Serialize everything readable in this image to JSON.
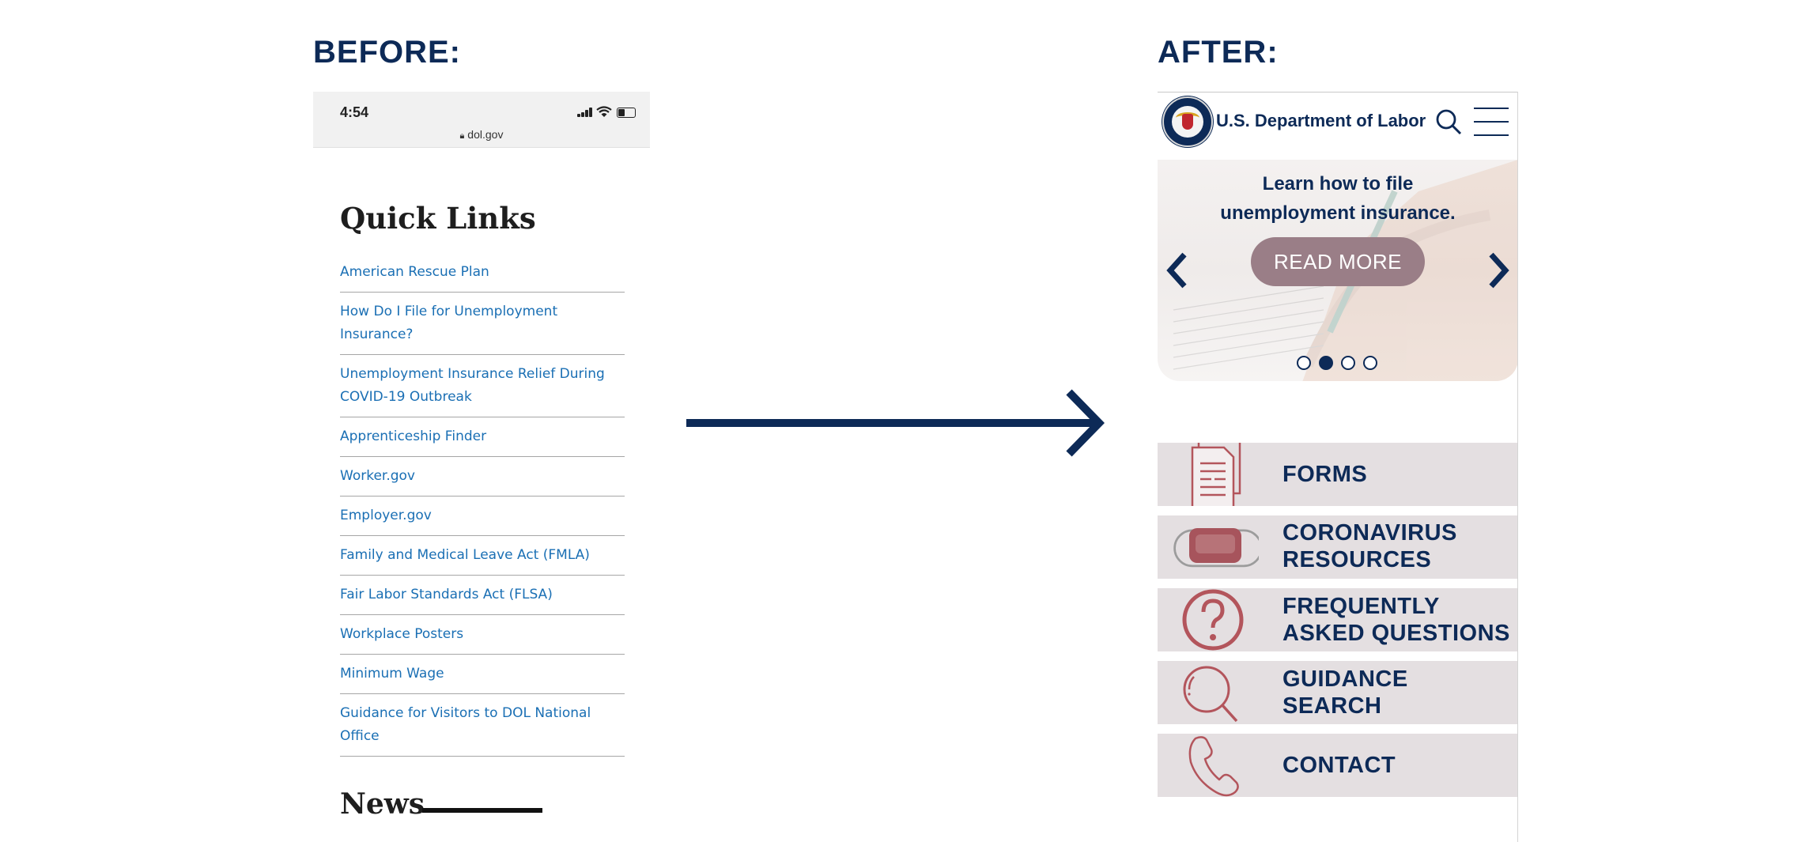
{
  "labels": {
    "before": "BEFORE:",
    "after": "AFTER:"
  },
  "colors": {
    "navy": "#0d2a57",
    "link": "#1a6fb4",
    "tile_bg": "#e4dfe1",
    "icon_red": "#b3555c",
    "button_mauve": "#9a7e87"
  },
  "before": {
    "status": {
      "time": "4:54",
      "url": "dol.gov"
    },
    "quick_links": {
      "title": "Quick Links",
      "items": [
        {
          "label": "American Rescue Plan"
        },
        {
          "label": "How Do I File for Unemployment Insurance?"
        },
        {
          "label": "Unemployment Insurance Relief During COVID-19 Outbreak"
        },
        {
          "label": "Apprenticeship Finder"
        },
        {
          "label": "Worker.gov"
        },
        {
          "label": "Employer.gov"
        },
        {
          "label": "Family and Medical Leave Act (FMLA)"
        },
        {
          "label": "Fair Labor Standards Act (FLSA)"
        },
        {
          "label": "Workplace Posters"
        },
        {
          "label": "Minimum Wage"
        },
        {
          "label": "Guidance for Visitors to DOL National Office"
        }
      ]
    },
    "news_title": "News"
  },
  "after": {
    "header": {
      "agency": "U.S. Department of Labor",
      "icons": [
        "dol-seal-icon",
        "search-icon",
        "hamburger-menu-icon"
      ]
    },
    "carousel": {
      "headline_line1": "Learn how to file",
      "headline_line2": "unemployment insurance.",
      "button": "READ MORE",
      "slide_count": 4,
      "active_slide": 2
    },
    "tiles": [
      {
        "line1": "FORMS",
        "line2": "",
        "icon": "document-icon"
      },
      {
        "line1": "CORONAVIRUS",
        "line2": "RESOURCES",
        "icon": "face-mask-icon"
      },
      {
        "line1": "FREQUENTLY",
        "line2": "ASKED QUESTIONS",
        "icon": "question-mark-icon"
      },
      {
        "line1": "GUIDANCE",
        "line2": "SEARCH",
        "icon": "magnifier-icon"
      },
      {
        "line1": "CONTACT",
        "line2": "",
        "icon": "phone-icon"
      }
    ]
  }
}
